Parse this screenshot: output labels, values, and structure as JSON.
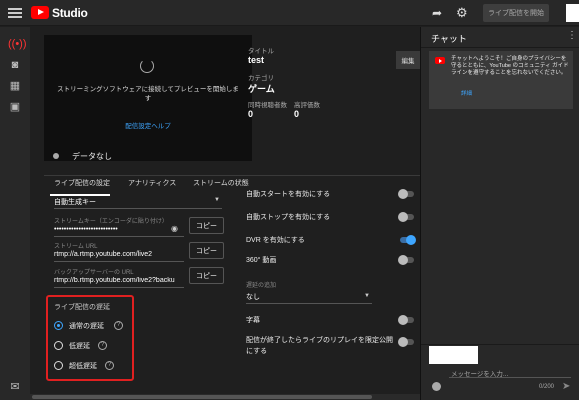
{
  "header": {
    "app_name": "Studio",
    "start_button_label": "ライブ配信を開始"
  },
  "preview": {
    "message": "ストリーミングソフトウェアに接続してプレビューを開始します",
    "help_link": "配信設定ヘルプ"
  },
  "stream_info": {
    "title_label": "タイトル",
    "title_value": "test",
    "category_label": "カテゴリ",
    "category_value": "ゲーム",
    "concurrent_label": "同時視聴者数",
    "concurrent_value": "0",
    "likes_label": "高評価数",
    "likes_value": "0",
    "edit_label": "編集"
  },
  "status": {
    "text": "データなし"
  },
  "tabs": [
    {
      "label": "ライブ配信の設定"
    },
    {
      "label": "アナリティクス"
    },
    {
      "label": "ストリームの状態"
    }
  ],
  "stream_key": {
    "mode_value": "自動生成キー",
    "key_label": "ストリームキー（エンコーダに貼り付け）",
    "key_value": "••••••••••••••••••••••••••",
    "copy_label": "コピー"
  },
  "stream_url": {
    "label": "ストリーム URL",
    "value": "rtmp://a.rtmp.youtube.com/live2"
  },
  "backup_url": {
    "label": "バックアップサーバーの URL",
    "value": "rtmp://b.rtmp.youtube.com/live2?backu"
  },
  "latency": {
    "title": "ライブ配信の遅延",
    "options": [
      {
        "label": "通常の遅延",
        "selected": true
      },
      {
        "label": "低遅延",
        "selected": false
      },
      {
        "label": "超低遅延",
        "selected": false
      }
    ]
  },
  "settings": {
    "auto_start_label": "自動スタートを有効にする",
    "auto_start_on": false,
    "auto_stop_label": "自動ストップを有効にする",
    "auto_stop_on": false,
    "dvr_label": "DVR を有効にする",
    "dvr_on": true,
    "video360_label": "360° 動画",
    "video360_on": false,
    "delay_label": "遅延の追加",
    "delay_value": "なし",
    "captions_label": "字幕",
    "captions_on": false,
    "replay_label": "配信が終了したらライブのリプレイを限定公開にする",
    "replay_on": false
  },
  "chat": {
    "title": "チャット",
    "welcome_text": "チャットへようこそ！ご自身のプライバシーを守るとともに、YouTube のコミュニティ ガイドラインを遵守することを忘れないでください。",
    "welcome_link": "詳細",
    "input_placeholder": "メッセージを入力...",
    "char_count": "0/200"
  },
  "colors": {
    "accent": "#3ea6ff",
    "highlight_box": "#e02020",
    "brand_red": "#ff0000"
  }
}
